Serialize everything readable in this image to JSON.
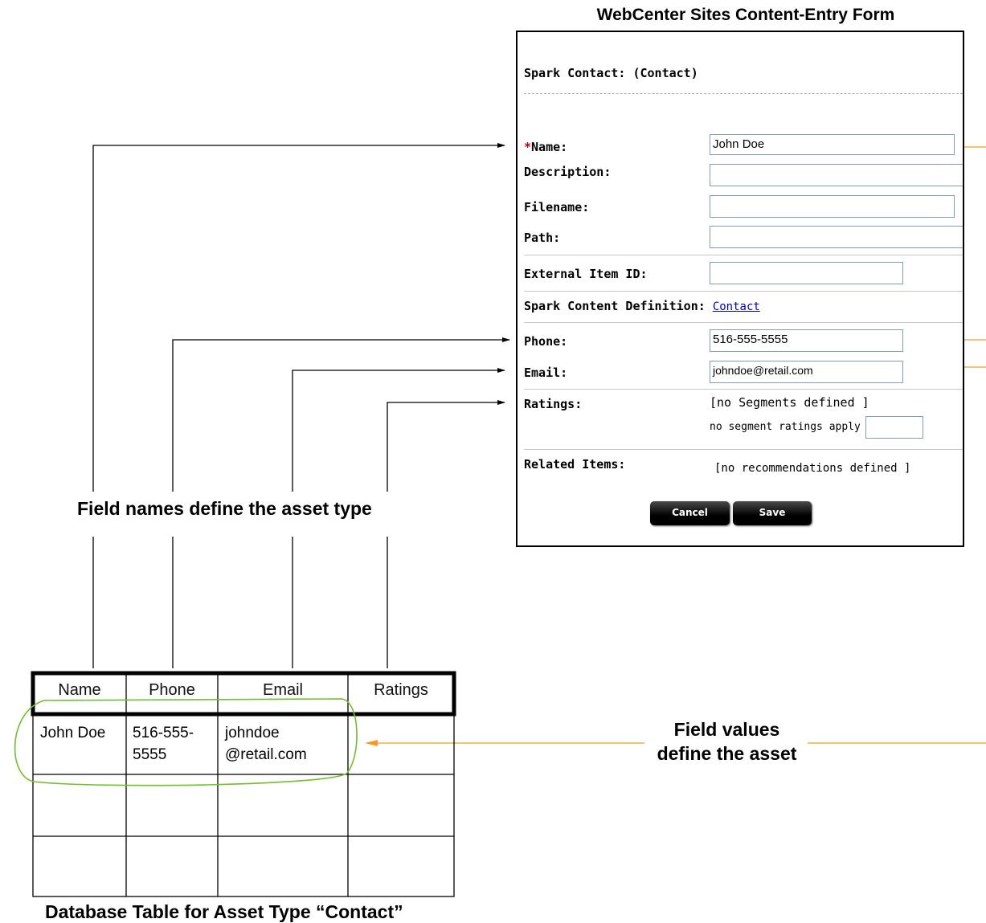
{
  "form": {
    "title": "WebCenter Sites Content-Entry Form",
    "heading": "Spark Contact: (Contact)",
    "required_mark": "*",
    "fields": {
      "name": {
        "label": "Name:",
        "value": "John Doe"
      },
      "description": {
        "label": "Description:",
        "value": ""
      },
      "filename": {
        "label": "Filename:",
        "value": ""
      },
      "path": {
        "label": "Path:",
        "value": ""
      },
      "external_id": {
        "label": "External Item ID:",
        "value": ""
      },
      "definition": {
        "label": "Spark Content Definition:",
        "link": "Contact"
      },
      "phone": {
        "label": "Phone:",
        "value": "516-555-5555"
      },
      "email": {
        "label": "Email:",
        "value": "johndoe@retail.com"
      },
      "ratings": {
        "label": "Ratings:",
        "note": "[no Segments defined ]",
        "sub": "no segment ratings apply",
        "value": ""
      },
      "related": {
        "label": "Related Items:",
        "note": "[no recommendations defined ]"
      }
    },
    "buttons": {
      "cancel": "Cancel",
      "save": "Save"
    }
  },
  "captions": {
    "field_names": "Field names define the asset type",
    "field_values_line1": "Field values",
    "field_values_line2": "define the asset",
    "table": "Database Table for Asset Type “Contact”"
  },
  "table": {
    "headers": [
      "Name",
      "Phone",
      "Email",
      "Ratings"
    ],
    "row1": {
      "name": "John Doe",
      "phone_line1": "516-555-",
      "phone_line2": "5555",
      "email_line1": "johndoe",
      "email_line2": "@retail.com",
      "ratings": ""
    }
  },
  "colors": {
    "connector": "#000000",
    "value_connector": "#f39c1e",
    "highlight_oval": "#6fbf2a",
    "required": "#d00000",
    "link": "#0000cc",
    "input_border": "#7f9db9"
  }
}
